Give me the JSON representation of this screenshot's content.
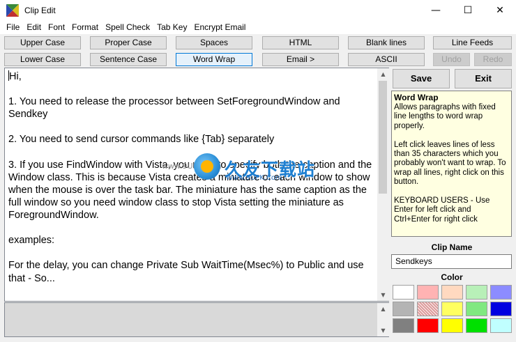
{
  "window": {
    "title": "Clip Edit",
    "minimize_glyph": "—",
    "maximize_glyph": "☐",
    "close_glyph": "✕"
  },
  "menu": [
    "File",
    "Edit",
    "Font",
    "Format",
    "Spell Check",
    "Tab Key",
    "Encrypt Email"
  ],
  "toolbar": {
    "upper_case": "Upper Case",
    "proper_case": "Proper Case",
    "spaces": "Spaces",
    "html": "HTML",
    "blank_lines": "Blank lines",
    "line_feeds": "Line Feeds",
    "lower_case": "Lower Case",
    "sentence_case": "Sentence Case",
    "word_wrap": "Word Wrap",
    "email": "Email >",
    "ascii": "ASCII",
    "undo": "Undo",
    "redo": "Redo"
  },
  "editor": {
    "text": "Hi,\n\n1. You need to release the processor between SetForegroundWindow and Sendkey\n\n2. You need to send cursor commands like {Tab} separately\n\n3. If you use FindWindow with Vista, you need to specify both the caption and the Window class. This is because Vista creates a miniature of each window to show when the mouse is over the task bar. The miniature has the same caption as the full window so you need window class to stop Vista setting the miniature as ForegroundWindow.\n\nexamples:\n\nFor the delay, you can change Private Sub WaitTime(Msec%) to Public and use that - So..."
  },
  "actions": {
    "save": "Save",
    "exit": "Exit"
  },
  "help": {
    "title": "Word Wrap",
    "body": "Allows paragraphs with fixed line lengths to word wrap properly.\n\nLeft click leaves lines of less than 35 characters which you probably won't want to wrap. To wrap all lines, right click on this button.\n\nKEYBOARD USERS - Use Enter for left click and Ctrl+Enter for right click"
  },
  "clip_name": {
    "label": "Clip Name",
    "value": "Sendkeys"
  },
  "color": {
    "label": "Color",
    "swatches": [
      [
        "#ffffff",
        "#ffb3b3",
        "#ffd9c0",
        "#b8f0b8",
        "#8c8cff"
      ],
      [
        "#b4b4b4",
        "pattern",
        "#ffff60",
        "#80e880",
        "#0000e0"
      ],
      [
        "#808080",
        "#ff0000",
        "#ffff00",
        "#00e000",
        "#c0ffff"
      ]
    ]
  },
  "watermark": {
    "logo_text": "久友下载站",
    "small_text": "www.9UPK.com",
    "url": "Www.9UPK.Com"
  }
}
